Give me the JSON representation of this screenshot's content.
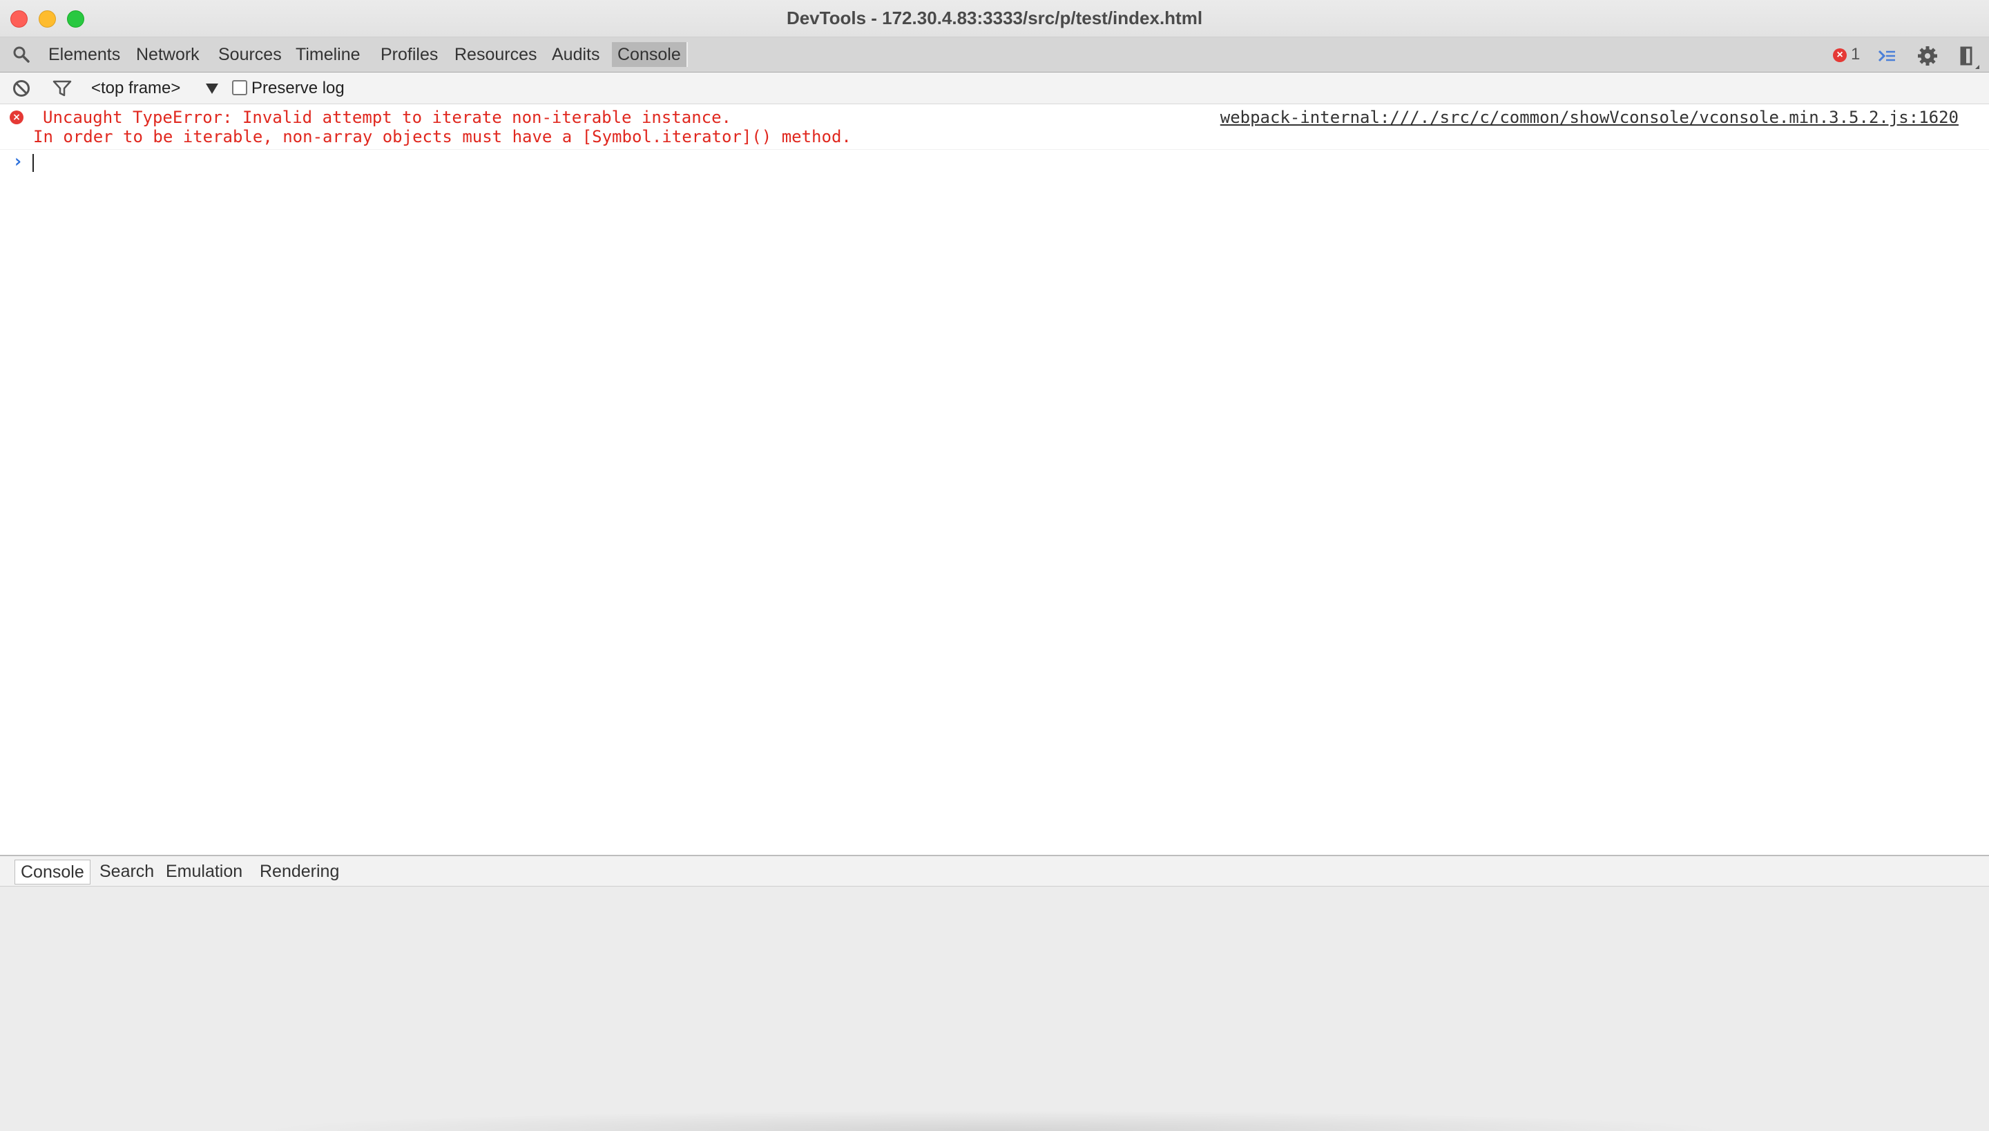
{
  "window": {
    "title": "DevTools - 172.30.4.83:3333/src/p/test/index.html"
  },
  "main_tabs": [
    {
      "label": "Elements",
      "active": false
    },
    {
      "label": "Network",
      "active": false
    },
    {
      "label": "Sources",
      "active": false
    },
    {
      "label": "Timeline",
      "active": false
    },
    {
      "label": "Profiles",
      "active": false
    },
    {
      "label": "Resources",
      "active": false
    },
    {
      "label": "Audits",
      "active": false
    },
    {
      "label": "Console",
      "active": true
    }
  ],
  "toolbar_right": {
    "error_count": "1",
    "icons": [
      "error-icon",
      "console-drawer-icon",
      "gear-icon",
      "dock-side-icon"
    ]
  },
  "console_toolbar": {
    "icons": [
      "clear-icon",
      "filter-icon"
    ],
    "frame_selector": "<top frame>",
    "preserve_log_label": "Preserve log",
    "preserve_log_checked": false
  },
  "messages": [
    {
      "level": "error",
      "line1": "Uncaught TypeError: Invalid attempt to iterate non-iterable instance.",
      "line2": "In order to be iterable, non-array objects must have a [Symbol.iterator]() method.",
      "source": "webpack-internal:///./src/c/common/showVconsole/vconsole.min.3.5.2.js:1620"
    }
  ],
  "prompt": {
    "caret": "›",
    "value": ""
  },
  "drawer_tabs": [
    {
      "label": "Console",
      "active": true
    },
    {
      "label": "Search",
      "active": false
    },
    {
      "label": "Emulation",
      "active": false
    },
    {
      "label": "Rendering",
      "active": false
    }
  ],
  "colors": {
    "error_text": "#e0281f",
    "active_tab_bg": "#b8b8b8",
    "prompt_caret": "#2a6fdb"
  }
}
